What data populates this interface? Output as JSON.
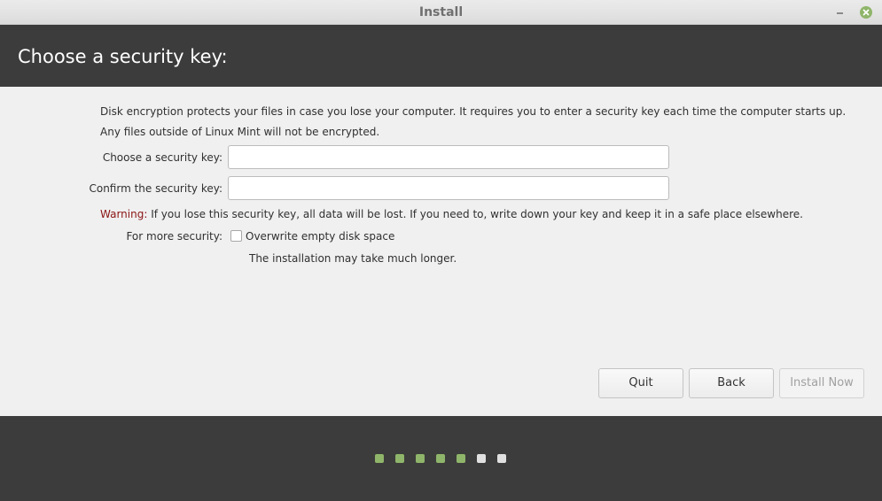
{
  "window": {
    "title": "Install"
  },
  "header": {
    "title": "Choose a security key:"
  },
  "content": {
    "intro_line1": "Disk encryption protects your files in case you lose your computer. It requires you to enter a security key each time the computer starts up.",
    "intro_line2": "Any files outside of Linux Mint will not be encrypted.",
    "key_label": "Choose a security key:",
    "key_value": "",
    "confirm_label": "Confirm the security key:",
    "confirm_value": "",
    "warning_label": "Warning:",
    "warning_text": " If you lose this security key, all data will be lost. If you need to, write down your key and keep it in a safe place elsewhere.",
    "security_label": "For more security:",
    "overwrite_label": "Overwrite empty disk space",
    "overwrite_checked": false,
    "overwrite_note": "The installation may take much longer."
  },
  "buttons": {
    "quit": "Quit",
    "back": "Back",
    "install": "Install Now"
  },
  "progress": {
    "total_steps": 7,
    "completed_steps": 5,
    "done_color": "#8fb56a",
    "pending_color": "#e0e0e0"
  },
  "colors": {
    "header_bg": "#3c3c3c",
    "accent": "#8fb56a",
    "warning": "#8b1414"
  }
}
